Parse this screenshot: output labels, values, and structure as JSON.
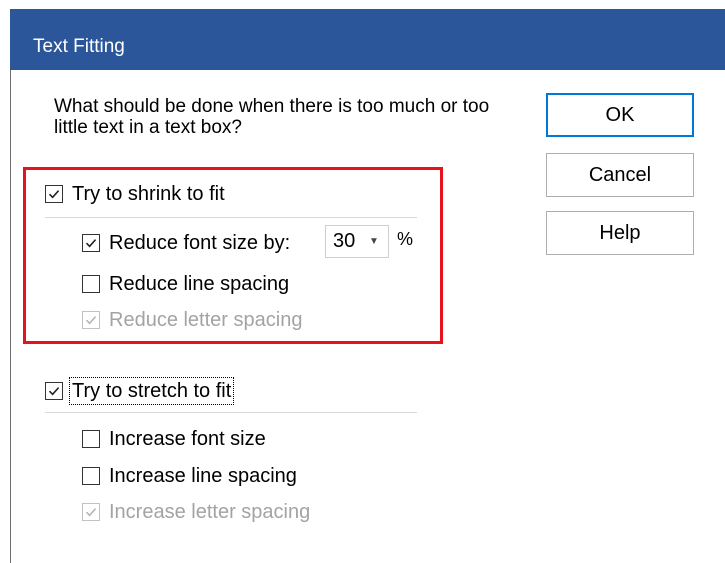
{
  "dialog": {
    "title": "Text Fitting",
    "question": "What should be done when there is too much or too little text in a text box?"
  },
  "buttons": {
    "ok": "OK",
    "cancel": "Cancel",
    "help": "Help"
  },
  "shrink": {
    "label": "Try to shrink to fit",
    "checked": true,
    "options": [
      {
        "label": "Reduce font size by:",
        "checked": true,
        "enabled": true
      },
      {
        "label": "Reduce line spacing",
        "checked": false,
        "enabled": true
      },
      {
        "label": "Reduce letter spacing",
        "checked": true,
        "enabled": false
      }
    ],
    "font_size_value": "30",
    "unit": "%"
  },
  "stretch": {
    "label": "Try to stretch to fit",
    "checked": true,
    "options": [
      {
        "label": "Increase font size",
        "checked": false,
        "enabled": true
      },
      {
        "label": "Increase line spacing",
        "checked": false,
        "enabled": true
      },
      {
        "label": "Increase letter spacing",
        "checked": true,
        "enabled": false
      }
    ]
  },
  "colors": {
    "titlebar": "#2b579a",
    "highlight_border": "#e8131a",
    "ok_border": "#0078d7",
    "disabled_text": "#a3a3a3"
  }
}
